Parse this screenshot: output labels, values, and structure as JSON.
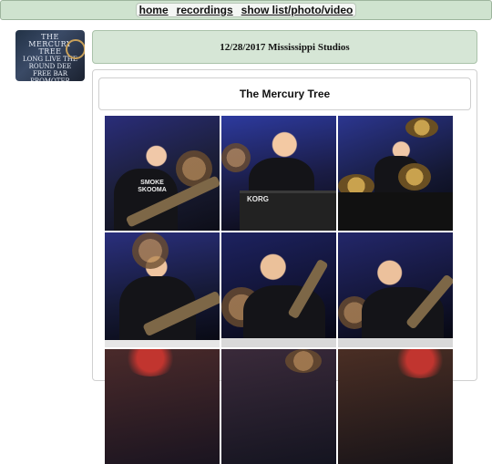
{
  "nav": {
    "links": [
      "home",
      "recordings",
      "show list/photo/video"
    ]
  },
  "show": {
    "date_venue": "12/28/2017 Mississippi Studios",
    "band": "The Mercury Tree"
  },
  "thumbnail": {
    "logo_lines": [
      "THE MERCURY TREE",
      "LONG LIVE THE",
      "ROUND DEE",
      "FREE BAR PROMOTER"
    ]
  },
  "photos": [
    {
      "shirt_text": "SMOKE SKOOMA"
    },
    {
      "keyboard_label": "KORG"
    },
    {},
    {},
    {},
    {},
    {},
    {},
    {}
  ],
  "colors": {
    "nav_bg": "#cfe3cf",
    "header_bg": "#d6e6d6"
  }
}
